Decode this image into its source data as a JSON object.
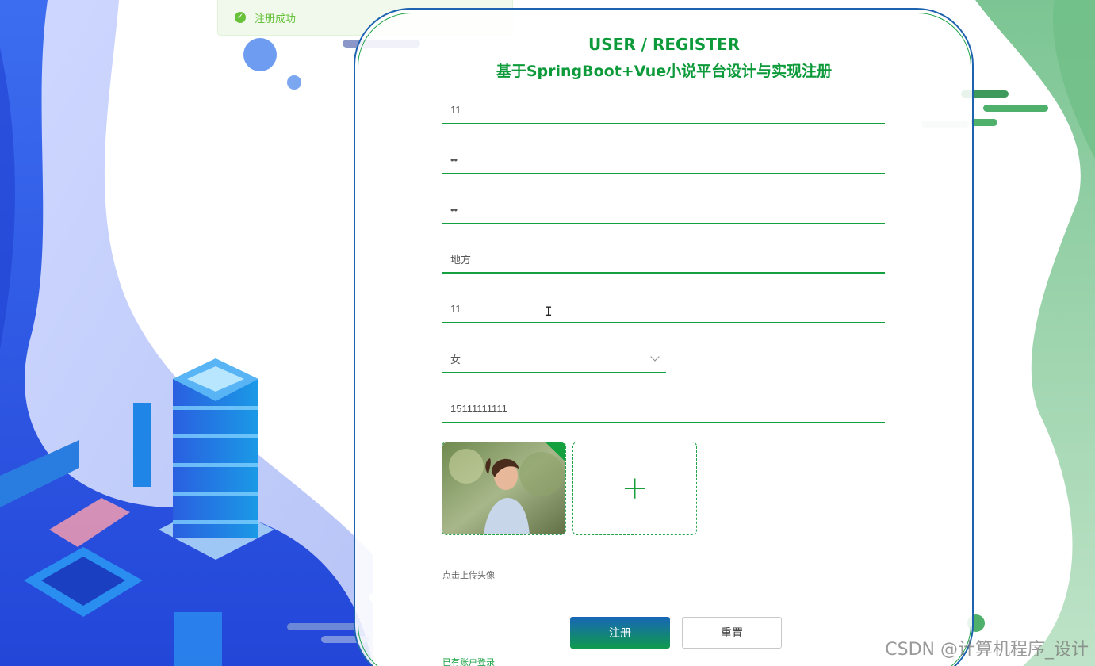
{
  "toast": {
    "message": "注册成功",
    "icon": "check-circle-icon",
    "color": "#67c23a"
  },
  "header": {
    "title_en": "USER / REGISTER",
    "title_cn": "基于SpringBoot+Vue小说平台设计与实现注册"
  },
  "form": {
    "fields": [
      {
        "name": "account",
        "value": "11"
      },
      {
        "name": "password",
        "value": "••"
      },
      {
        "name": "confirm_password",
        "value": "••"
      },
      {
        "name": "nickname",
        "value": "地方"
      },
      {
        "name": "age",
        "value": "11"
      }
    ],
    "gender": {
      "value": "女",
      "icon": "chevron-down-icon"
    },
    "phone": {
      "value": "15111111111"
    },
    "upload_add_icon": "+",
    "upload_hint": "点击上传头像"
  },
  "buttons": {
    "register": "注册",
    "reset": "重置"
  },
  "login_link": "已有账户登录",
  "watermark": "CSDN @计算机程序_设计",
  "colors": {
    "accent": "#15a03f",
    "panel_border": "#1e63b0",
    "bg_blue": "#2e5be8",
    "bg_green": "#8fcca0"
  }
}
